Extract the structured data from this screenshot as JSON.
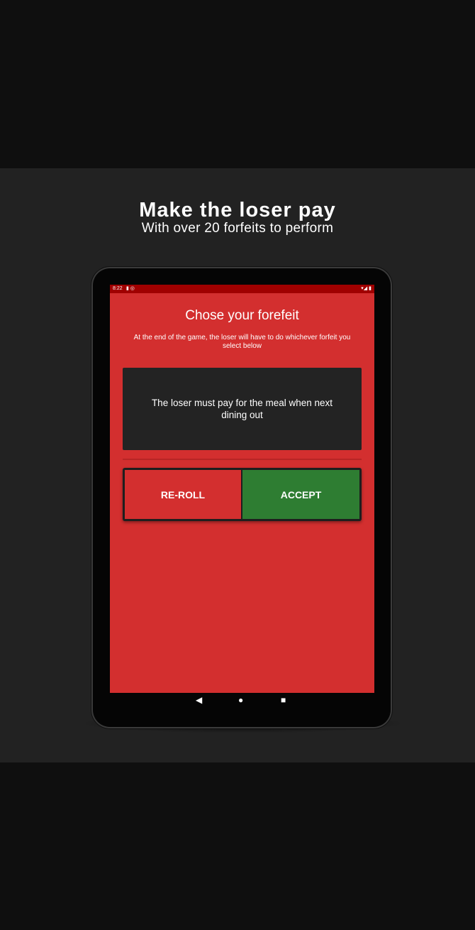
{
  "promo": {
    "headline": "Make the loser pay",
    "subheadline": "With over 20 forfeits to perform"
  },
  "status_bar": {
    "time": "8:22",
    "left_icons": "▮ ◎",
    "right_icons": "▾◢ ▮"
  },
  "screen": {
    "title": "Chose your forefeit",
    "subtitle": "At the end of the game, the loser will have to do whichever forfeit you select below",
    "forfeit_text": "The loser must pay for the meal when next dining out",
    "buttons": {
      "reroll": "RE-ROLL",
      "accept": "ACCEPT"
    }
  },
  "nav_bar": {
    "back": "◀",
    "home": "●",
    "recent": "■"
  },
  "colors": {
    "screen_bg": "#d32f2f",
    "status_bar": "#a00000",
    "card_bg": "#232323",
    "accept_green": "#2e7d32",
    "page_band": "#222222",
    "page_bg": "#0f0f0f"
  },
  "icons": [
    "back-icon",
    "home-icon",
    "recent-apps-icon",
    "wifi-icon",
    "battery-icon"
  ]
}
